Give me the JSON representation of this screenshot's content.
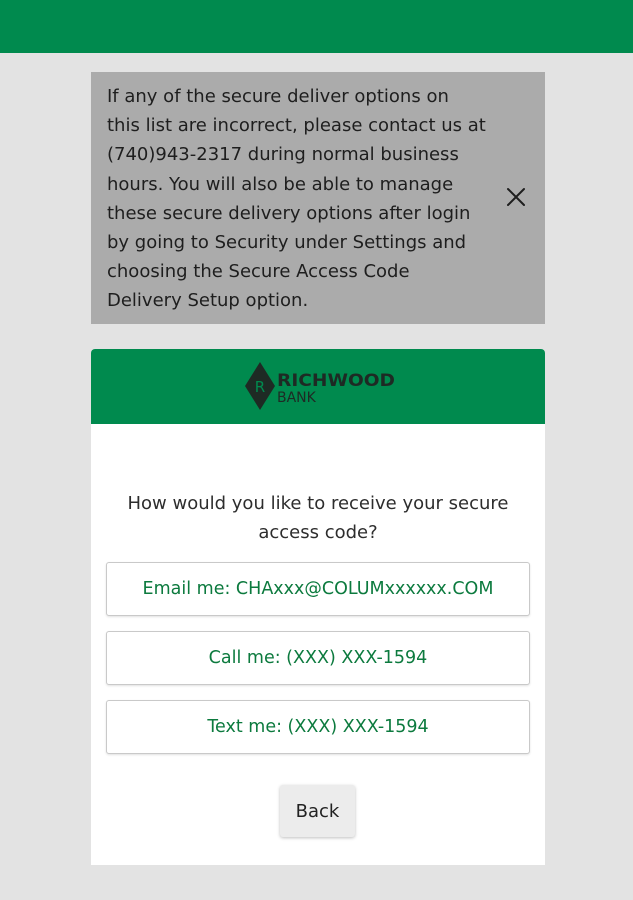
{
  "header": {
    "brand_color": "#008a4e"
  },
  "notice": {
    "message": "If any of the secure deliver options on this list are incorrect, please contact us at (740)943-2317 during normal business hours. You will also be able to manage these secure delivery options after login by going to Security under Settings and choosing the Secure Access Code Delivery Setup option.",
    "close_icon": "close-icon"
  },
  "card": {
    "logo": {
      "line1": "RICHWOOD",
      "line2": "BANK",
      "letter": "R"
    },
    "prompt": "How would you like to receive your secure access code?",
    "options": [
      {
        "label": "Email me: CHAxxx@COLUMxxxxxx.COM"
      },
      {
        "label": "Call me: (XXX) XXX-1594"
      },
      {
        "label": "Text me: (XXX) XXX-1594"
      }
    ],
    "back_label": "Back"
  },
  "colors": {
    "accent_green": "#008a4e",
    "option_text": "#0c7a3e",
    "notice_bg": "#ababab",
    "page_bg": "#e3e3e3"
  }
}
